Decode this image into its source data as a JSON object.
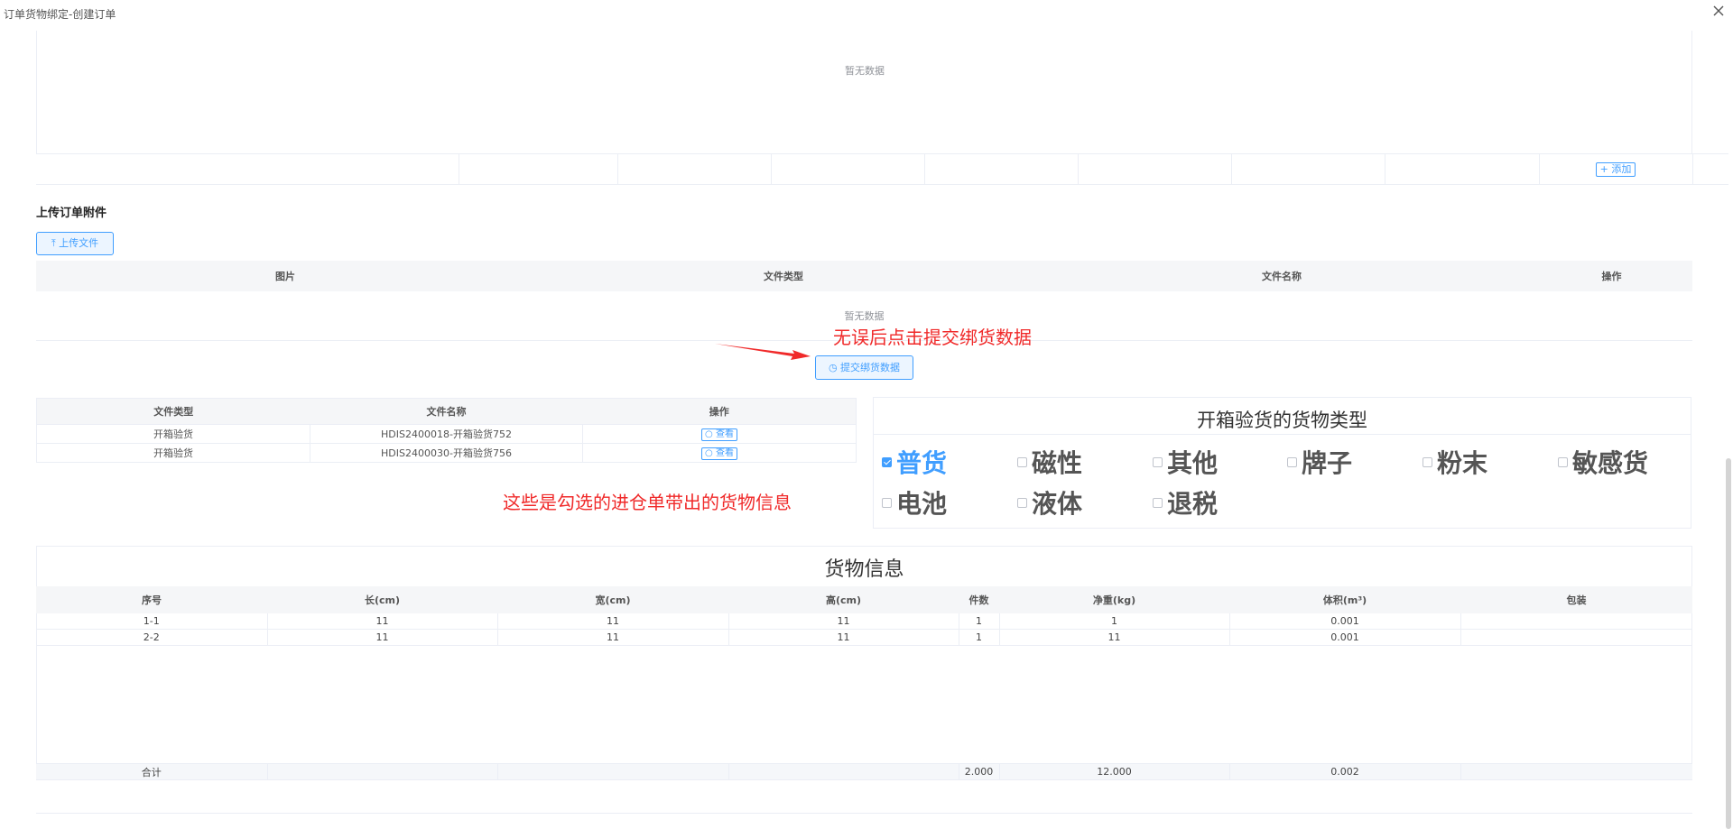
{
  "window": {
    "title": "订单货物绑定-创建订单"
  },
  "top_table": {
    "empty_text": "暂无数据",
    "add_label": "+ 添加"
  },
  "attachments": {
    "section_title": "上传订单附件",
    "upload_label": "上传文件",
    "columns": [
      "图片",
      "文件类型",
      "文件名称",
      "操作"
    ],
    "empty_text": "暂无数据"
  },
  "annotations": {
    "submit_hint": "无误后点击提交绑货数据",
    "cargo_hint": "这些是勾选的进仓单带出的货物信息"
  },
  "submit_label": "提交绑货数据",
  "files": {
    "columns": [
      "文件类型",
      "文件名称",
      "操作"
    ],
    "rows": [
      {
        "type": "开箱验货",
        "name": "HDIS2400018-开箱验货752",
        "action": "查看"
      },
      {
        "type": "开箱验货",
        "name": "HDIS2400030-开箱验货756",
        "action": "查看"
      }
    ]
  },
  "cargo_types": {
    "title": "开箱验货的货物类型",
    "items": [
      {
        "label": "普货",
        "checked": true
      },
      {
        "label": "磁性",
        "checked": false
      },
      {
        "label": "其他",
        "checked": false
      },
      {
        "label": "牌子",
        "checked": false
      },
      {
        "label": "粉末",
        "checked": false
      },
      {
        "label": "敏感货",
        "checked": false
      },
      {
        "label": "电池",
        "checked": false
      },
      {
        "label": "液体",
        "checked": false
      },
      {
        "label": "退税",
        "checked": false
      }
    ]
  },
  "goods": {
    "title": "货物信息",
    "columns": [
      "序号",
      "长(cm)",
      "宽(cm)",
      "高(cm)",
      "件数",
      "净重(kg)",
      "体积(m³)",
      "包装"
    ],
    "rows": [
      [
        "1-1",
        "11",
        "11",
        "11",
        "1",
        "1",
        "0.001",
        ""
      ],
      [
        "2-2",
        "11",
        "11",
        "11",
        "1",
        "11",
        "0.001",
        ""
      ]
    ],
    "total": [
      "合计",
      "",
      "",
      "",
      "2.000",
      "12.000",
      "0.002",
      ""
    ]
  },
  "colors": {
    "accent": "#409eff",
    "annotation": "#f02a2a"
  }
}
